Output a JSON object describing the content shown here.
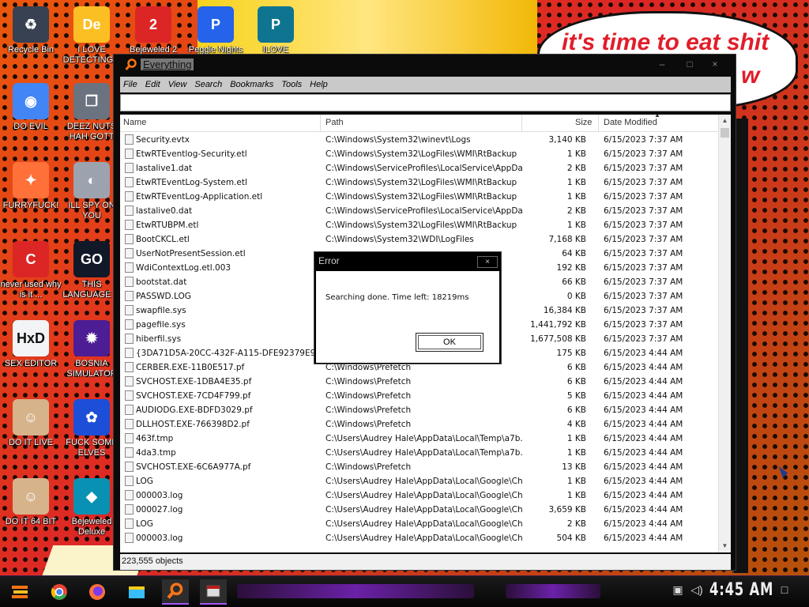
{
  "desktop": {
    "speech_bubble": {
      "line1": "it's time to eat shit",
      "line2": "w"
    },
    "icons": [
      {
        "label": "Recycle Bin",
        "icon": "recycle-bin-icon"
      },
      {
        "label": "I LOVE DETECTING...",
        "icon": "de-icon"
      },
      {
        "label": "Bejeweled 2",
        "icon": "bejeweled2-icon"
      },
      {
        "label": "Peggle Nights",
        "icon": "peggle-icon"
      },
      {
        "label": "ILOVE",
        "icon": "project-icon"
      },
      {
        "label": "DO EVIL",
        "icon": "chrome-icon"
      },
      {
        "label": "DEEZ NUTS HAH GOTT",
        "icon": "copy-icon"
      },
      {
        "label": "FURRYFUCK!",
        "icon": "firefox-icon"
      },
      {
        "label": "ILL SPY ON YOU",
        "icon": "spy-icon"
      },
      {
        "label": "never used why is it ...",
        "icon": "devcpp-icon"
      },
      {
        "label": "THIS LANGUAGE ...",
        "icon": "goland-icon"
      },
      {
        "label": "SEX EDITOR",
        "icon": "hxd-icon"
      },
      {
        "label": "BOSNIA SIMULATOR",
        "icon": "mine-icon"
      },
      {
        "label": "DO IT LIVE",
        "icon": "portrait-icon"
      },
      {
        "label": "FUCK SOME ELVES",
        "icon": "elf-icon"
      },
      {
        "label": "DO IT 64 BIT",
        "icon": "portrait64-icon"
      },
      {
        "label": "Bejeweled Deluxe",
        "icon": "diamond-icon"
      }
    ]
  },
  "window": {
    "title": "Everything",
    "menu": [
      "File",
      "Edit",
      "View",
      "Search",
      "Bookmarks",
      "Tools",
      "Help"
    ],
    "search_value": "",
    "columns": {
      "name": "Name",
      "path": "Path",
      "size": "Size",
      "date": "Date Modified"
    },
    "rows": [
      {
        "name": "Security.evtx",
        "path": "C:\\Windows\\System32\\winevt\\Logs",
        "size": "3,140 KB",
        "date": "6/15/2023 7:37 AM"
      },
      {
        "name": "EtwRTEventlog-Security.etl",
        "path": "C:\\Windows\\System32\\LogFiles\\WMI\\RtBackup",
        "size": "1 KB",
        "date": "6/15/2023 7:37 AM"
      },
      {
        "name": "lastalive1.dat",
        "path": "C:\\Windows\\ServiceProfiles\\LocalService\\AppDat...",
        "size": "2 KB",
        "date": "6/15/2023 7:37 AM"
      },
      {
        "name": "EtwRTEventLog-System.etl",
        "path": "C:\\Windows\\System32\\LogFiles\\WMI\\RtBackup",
        "size": "1 KB",
        "date": "6/15/2023 7:37 AM"
      },
      {
        "name": "EtwRTEventLog-Application.etl",
        "path": "C:\\Windows\\System32\\LogFiles\\WMI\\RtBackup",
        "size": "1 KB",
        "date": "6/15/2023 7:37 AM"
      },
      {
        "name": "lastalive0.dat",
        "path": "C:\\Windows\\ServiceProfiles\\LocalService\\AppDat...",
        "size": "2 KB",
        "date": "6/15/2023 7:37 AM"
      },
      {
        "name": "EtwRTUBPM.etl",
        "path": "C:\\Windows\\System32\\LogFiles\\WMI\\RtBackup",
        "size": "1 KB",
        "date": "6/15/2023 7:37 AM"
      },
      {
        "name": "BootCKCL.etl",
        "path": "C:\\Windows\\System32\\WDI\\LogFiles",
        "size": "7,168 KB",
        "date": "6/15/2023 7:37 AM"
      },
      {
        "name": "UserNotPresentSession.etl",
        "path": "",
        "size": "64 KB",
        "date": "6/15/2023 7:37 AM"
      },
      {
        "name": "WdiContextLog.etl.003",
        "path": "",
        "size": "192 KB",
        "date": "6/15/2023 7:37 AM"
      },
      {
        "name": "bootstat.dat",
        "path": "",
        "size": "66 KB",
        "date": "6/15/2023 7:37 AM"
      },
      {
        "name": "PASSWD.LOG",
        "path": "",
        "size": "0 KB",
        "date": "6/15/2023 7:37 AM"
      },
      {
        "name": "swapfile.sys",
        "path": "",
        "size": "16,384 KB",
        "date": "6/15/2023 7:37 AM"
      },
      {
        "name": "pagefile.sys",
        "path": "",
        "size": "1,441,792 KB",
        "date": "6/15/2023 7:37 AM"
      },
      {
        "name": "hiberfil.sys",
        "path": "",
        "size": "1,677,508 KB",
        "date": "6/15/2023 7:37 AM"
      },
      {
        "name": "{3DA71D5A-20CC-432F-A115-DFE92379E91F}...",
        "path": "",
        "size": "175 KB",
        "date": "6/15/2023 4:44 AM"
      },
      {
        "name": "CERBER.EXE-11B0E517.pf",
        "path": "C:\\Windows\\Prefetch",
        "size": "6 KB",
        "date": "6/15/2023 4:44 AM"
      },
      {
        "name": "SVCHOST.EXE-1DBA4E35.pf",
        "path": "C:\\Windows\\Prefetch",
        "size": "6 KB",
        "date": "6/15/2023 4:44 AM"
      },
      {
        "name": "SVCHOST.EXE-7CD4F799.pf",
        "path": "C:\\Windows\\Prefetch",
        "size": "5 KB",
        "date": "6/15/2023 4:44 AM"
      },
      {
        "name": "AUDIODG.EXE-BDFD3029.pf",
        "path": "C:\\Windows\\Prefetch",
        "size": "6 KB",
        "date": "6/15/2023 4:44 AM"
      },
      {
        "name": "DLLHOST.EXE-766398D2.pf",
        "path": "C:\\Windows\\Prefetch",
        "size": "4 KB",
        "date": "6/15/2023 4:44 AM"
      },
      {
        "name": "463f.tmp",
        "path": "C:\\Users\\Audrey Hale\\AppData\\Local\\Temp\\a7b...",
        "size": "1 KB",
        "date": "6/15/2023 4:44 AM"
      },
      {
        "name": "4da3.tmp",
        "path": "C:\\Users\\Audrey Hale\\AppData\\Local\\Temp\\a7b...",
        "size": "1 KB",
        "date": "6/15/2023 4:44 AM"
      },
      {
        "name": "SVCHOST.EXE-6C6A977A.pf",
        "path": "C:\\Windows\\Prefetch",
        "size": "13 KB",
        "date": "6/15/2023 4:44 AM"
      },
      {
        "name": "LOG",
        "path": "C:\\Users\\Audrey Hale\\AppData\\Local\\Google\\Ch...",
        "size": "1 KB",
        "date": "6/15/2023 4:44 AM"
      },
      {
        "name": "000003.log",
        "path": "C:\\Users\\Audrey Hale\\AppData\\Local\\Google\\Ch...",
        "size": "1 KB",
        "date": "6/15/2023 4:44 AM"
      },
      {
        "name": "000027.log",
        "path": "C:\\Users\\Audrey Hale\\AppData\\Local\\Google\\Ch...",
        "size": "3,659 KB",
        "date": "6/15/2023 4:44 AM"
      },
      {
        "name": "LOG",
        "path": "C:\\Users\\Audrey Hale\\AppData\\Local\\Google\\Ch...",
        "size": "2 KB",
        "date": "6/15/2023 4:44 AM"
      },
      {
        "name": "000003.log",
        "path": "C:\\Users\\Audrey Hale\\AppData\\Local\\Google\\Ch...",
        "size": "504 KB",
        "date": "6/15/2023 4:44 AM"
      }
    ],
    "status": "223,555 objects",
    "buttons": {
      "minimize": "–",
      "maximize": "□",
      "close": "×"
    }
  },
  "dialog": {
    "title": "Error",
    "message": "Searching done. Time left: 18219ms",
    "ok": "OK",
    "close": "×"
  },
  "taskbar": {
    "clock": "4:45 AM",
    "items": [
      "start-icon",
      "chrome-icon",
      "firefox-icon",
      "file-explorer-icon",
      "everything-search-icon",
      "app-icon"
    ]
  }
}
